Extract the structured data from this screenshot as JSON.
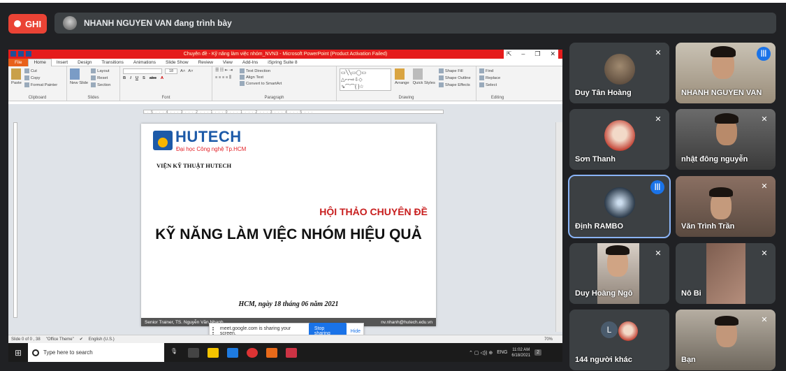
{
  "meet": {
    "record_label": "GHI",
    "presenter_text": "NHANH NGUYEN VAN đang trình bày",
    "colors": {
      "background": "#202124",
      "tile": "#3c4043",
      "record": "#ea4335",
      "accent": "#1a73e8"
    }
  },
  "powerpoint": {
    "title_bar": "Chuyên đề - Kỹ năng làm việc nhóm_NVN3 - Microsoft PowerPoint (Product Activation Failed)",
    "tabs": [
      "File",
      "Home",
      "Insert",
      "Design",
      "Transitions",
      "Animations",
      "Slide Show",
      "Review",
      "View",
      "Add-Ins",
      "iSpring Suite 8"
    ],
    "active_tab": "Home",
    "groups": {
      "clipboard": {
        "name": "Clipboard",
        "paste": "Paste",
        "cut": "Cut",
        "copy": "Copy",
        "format_painter": "Format Painter"
      },
      "slides": {
        "name": "Slides",
        "new_slide": "New Slide",
        "layout": "Layout",
        "reset": "Reset",
        "section": "Section"
      },
      "font": {
        "name": "Font",
        "size": "18"
      },
      "paragraph": {
        "name": "Paragraph",
        "text_direction": "Text Direction",
        "align_text": "Align Text",
        "smartart": "Convert to SmartArt"
      },
      "drawing": {
        "name": "Drawing",
        "arrange": "Arrange",
        "quick_styles": "Quick Styles",
        "shape_fill": "Shape Fill",
        "shape_outline": "Shape Outline",
        "shape_effects": "Shape Effects"
      },
      "editing": {
        "name": "Editing",
        "find": "Find",
        "replace": "Replace",
        "select": "Select"
      }
    },
    "slide": {
      "logo": "HUTECH",
      "logo_sub": "Đại học Công nghệ Tp.HCM",
      "institute": "VIỆN KỸ THUẬT HUTECH",
      "seminar": "HỘI THẢO CHUYÊN ĐỀ",
      "title": "KỸ NĂNG LÀM VIỆC NHÓM HIỆU QUẢ",
      "date": "HCM, ngày 18 tháng 06 năm 2021",
      "footer_left": "Senior Trainer, TS. Nguyễn Văn Nhanh",
      "footer_right": "nv.nhanh@hutech.edu.vn"
    },
    "share_banner": {
      "text": "meet.google.com is sharing your screen.",
      "stop": "Stop sharing",
      "hide": "Hide"
    },
    "status": {
      "slide_info": "Slide 0 of 0 , 38",
      "theme": "\"Office Theme\"",
      "language": "English (U.S.)",
      "zoom": "70%"
    }
  },
  "taskbar": {
    "search_placeholder": "Type here to search",
    "lang": "ENG",
    "time": "11:02 AM",
    "date": "6/18/2021",
    "notifications": "2"
  },
  "participants": [
    {
      "name": "Duy Tân Hoàng",
      "muted": true
    },
    {
      "name": "NHANH NGUYEN VAN",
      "muted": false,
      "speaking": true
    },
    {
      "name": "Sơn Thanh",
      "muted": true
    },
    {
      "name": "nhật đông nguyễn",
      "muted": true
    },
    {
      "name": "Định RAMBO",
      "muted": false,
      "speaking": true
    },
    {
      "name": "Văn Trình Trần",
      "muted": true
    },
    {
      "name": "Duy Hoàng Ngô",
      "muted": true
    },
    {
      "name": "Nô Bi",
      "muted": true
    },
    {
      "name": "144 người khác",
      "avatar_letter": "L"
    },
    {
      "name": "Bạn",
      "muted": true
    }
  ]
}
